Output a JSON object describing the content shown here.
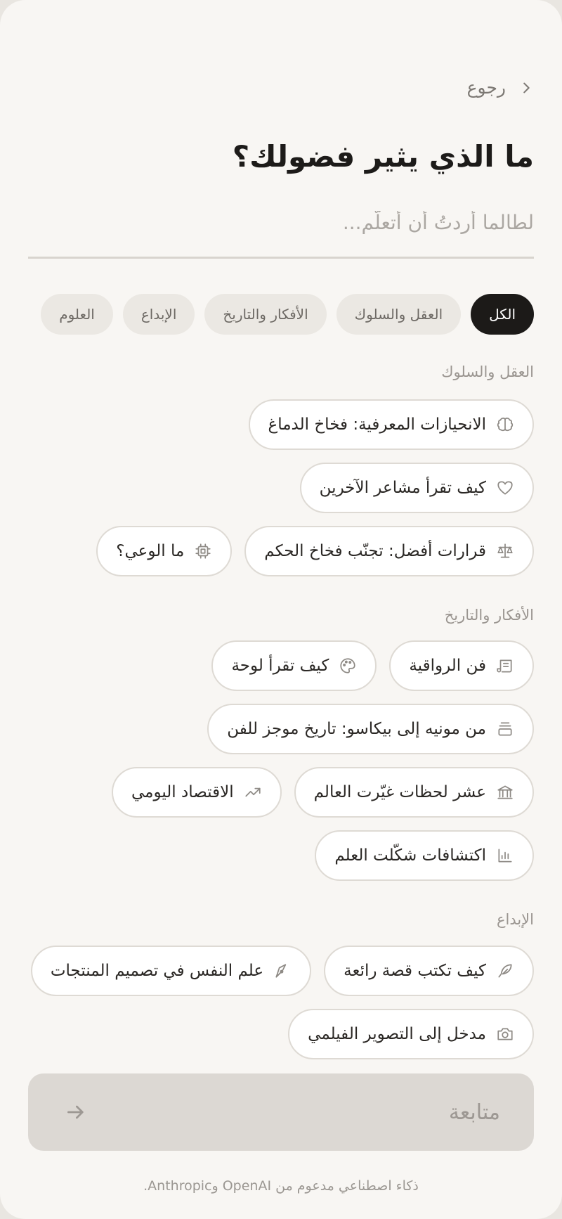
{
  "header": {
    "back_label": "رجوع",
    "title": "ما الذي يثير فضولك؟",
    "search_placeholder": "لطالما أردتُ أن أتعلَّم..."
  },
  "tabs": [
    {
      "label": "الكل",
      "active": true
    },
    {
      "label": "العقل والسلوك",
      "active": false
    },
    {
      "label": "الأفكار والتاريخ",
      "active": false
    },
    {
      "label": "الإبداع",
      "active": false
    },
    {
      "label": "العلوم",
      "active": false
    }
  ],
  "sections": {
    "mind": {
      "title": "العقل والسلوك",
      "topics": [
        {
          "label": "الانحيازات المعرفية: فخاخ الدماغ",
          "icon": "brain-icon"
        },
        {
          "label": "كيف تقرأ مشاعر الآخرين",
          "icon": "heart-icon"
        },
        {
          "label": "قرارات أفضل: تجنّب فخاخ الحكم",
          "icon": "scale-icon"
        },
        {
          "label": "ما الوعي؟",
          "icon": "chip-icon"
        }
      ]
    },
    "ideas": {
      "title": "الأفكار والتاريخ",
      "topics": [
        {
          "label": "فن الرواقية",
          "icon": "scroll-icon"
        },
        {
          "label": "كيف تقرأ لوحة",
          "icon": "palette-icon"
        },
        {
          "label": "من مونيه إلى بيكاسو: تاريخ موجز للفن",
          "icon": "frame-icon"
        },
        {
          "label": "عشر لحظات غيّرت العالم",
          "icon": "landmark-icon"
        },
        {
          "label": "الاقتصاد اليومي",
          "icon": "trend-icon"
        },
        {
          "label": "اكتشافات شكّلت العلم",
          "icon": "bar-chart-icon"
        }
      ]
    },
    "creativity": {
      "title": "الإبداع",
      "topics": [
        {
          "label": "كيف تكتب قصة رائعة",
          "icon": "feather-icon"
        },
        {
          "label": "علم النفس في تصميم المنتجات",
          "icon": "pen-tool-icon"
        },
        {
          "label": "مدخل إلى التصوير الفيلمي",
          "icon": "camera-icon"
        }
      ]
    }
  },
  "actions": {
    "continue_label": "متابعة"
  },
  "footer": {
    "text": "ذكاء اصطناعي مدعوم من OpenAI وAnthropic."
  }
}
